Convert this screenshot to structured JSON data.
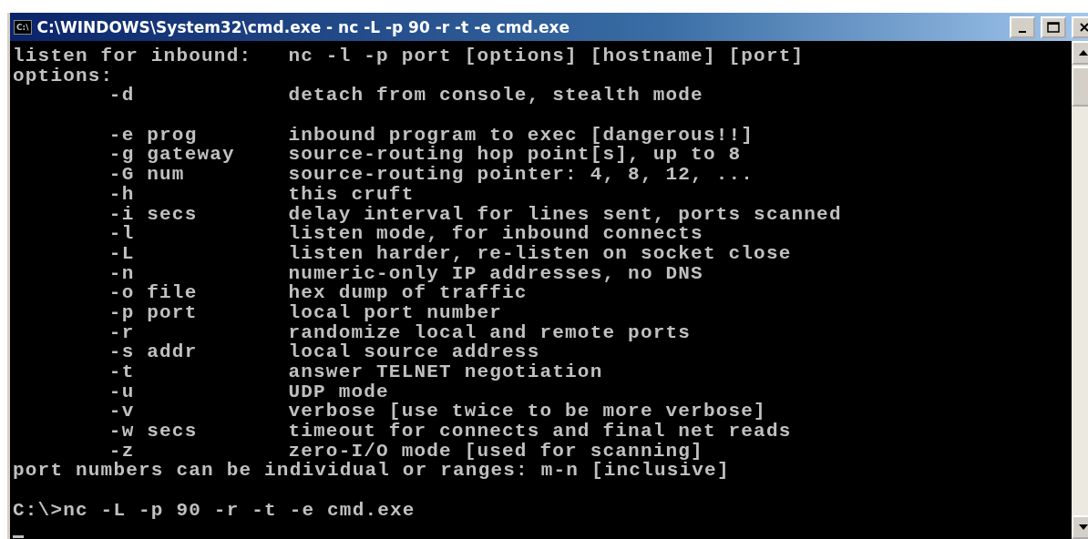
{
  "window": {
    "icon_text": "C:\\",
    "title": "C:\\WINDOWS\\System32\\cmd.exe - nc -L -p 90 -r -t -e cmd.exe"
  },
  "console": {
    "lines": [
      {
        "kind": "usage",
        "label": "listen for inbound:",
        "text": "nc -l -p port [options] [hostname] [port]"
      },
      {
        "kind": "text",
        "text": "options:"
      },
      {
        "kind": "option",
        "flag": "-d",
        "description": "detach from console, stealth mode"
      },
      {
        "kind": "blank"
      },
      {
        "kind": "option",
        "flag": "-e prog",
        "description": "inbound program to exec [dangerous!!]"
      },
      {
        "kind": "option",
        "flag": "-g gateway",
        "description": "source-routing hop point[s], up to 8"
      },
      {
        "kind": "option",
        "flag": "-G num",
        "description": "source-routing pointer: 4, 8, 12, ..."
      },
      {
        "kind": "option",
        "flag": "-h",
        "description": "this cruft"
      },
      {
        "kind": "option",
        "flag": "-i secs",
        "description": "delay interval for lines sent, ports scanned"
      },
      {
        "kind": "option",
        "flag": "-l",
        "description": "listen mode, for inbound connects"
      },
      {
        "kind": "option",
        "flag": "-L",
        "description": "listen harder, re-listen on socket close"
      },
      {
        "kind": "option",
        "flag": "-n",
        "description": "numeric-only IP addresses, no DNS"
      },
      {
        "kind": "option",
        "flag": "-o file",
        "description": "hex dump of traffic"
      },
      {
        "kind": "option",
        "flag": "-p port",
        "description": "local port number"
      },
      {
        "kind": "option",
        "flag": "-r",
        "description": "randomize local and remote ports"
      },
      {
        "kind": "option",
        "flag": "-s addr",
        "description": "local source address"
      },
      {
        "kind": "option",
        "flag": "-t",
        "description": "answer TELNET negotiation"
      },
      {
        "kind": "option",
        "flag": "-u",
        "description": "UDP mode"
      },
      {
        "kind": "option",
        "flag": "-v",
        "description": "verbose [use twice to be more verbose]"
      },
      {
        "kind": "option",
        "flag": "-w secs",
        "description": "timeout for connects and final net reads"
      },
      {
        "kind": "option",
        "flag": "-z",
        "description": "zero-I/O mode [used for scanning]"
      },
      {
        "kind": "text",
        "text": "port numbers can be individual or ranges: m-n [inclusive]"
      },
      {
        "kind": "blank"
      },
      {
        "kind": "prompt",
        "text": "C:\\>nc -L -p 90 -r -t -e cmd.exe"
      },
      {
        "kind": "cursor"
      }
    ]
  }
}
